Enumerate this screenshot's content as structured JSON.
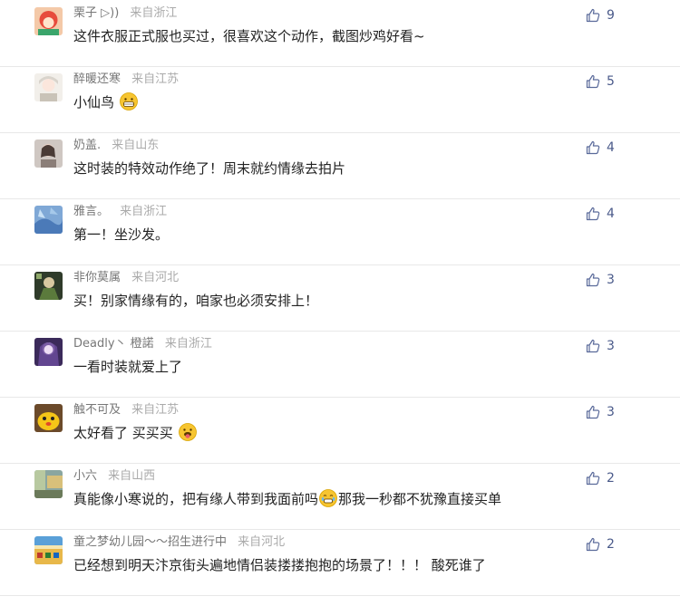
{
  "comments": [
    {
      "username": "栗子 ▷))",
      "location": "来自浙江",
      "likes": "9",
      "text": "这件衣服正式服也买过，很喜欢这个动作，截图炒鸡好看~",
      "text_after": ""
    },
    {
      "username": "醉暖还寒",
      "location": "来自江苏",
      "likes": "5",
      "text": "小仙鸟",
      "text_after": ""
    },
    {
      "username": "奶盖.",
      "location": "来自山东",
      "likes": "4",
      "text": "这时装的特效动作绝了！周末就约情缘去拍片",
      "text_after": ""
    },
    {
      "username": "雅言。",
      "location": "来自浙江",
      "likes": "4",
      "text": "第一！坐沙发。",
      "text_after": ""
    },
    {
      "username": "非你莫属",
      "location": "来自河北",
      "likes": "3",
      "text": "买！别家情缘有的，咱家也必须安排上！",
      "text_after": ""
    },
    {
      "username": "Deadly丶 橙諾",
      "location": "来自浙江",
      "likes": "3",
      "text": "一看时装就爱上了",
      "text_after": ""
    },
    {
      "username": "触不可及",
      "location": "来自江苏",
      "likes": "3",
      "text": "太好看了 买买买",
      "text_after": ""
    },
    {
      "username": "小六",
      "location": "来自山西",
      "likes": "2",
      "text": "真能像小寒说的，把有缘人带到我面前吗",
      "text_after": "那我一秒都不犹豫直接买单"
    },
    {
      "username": "童之梦幼儿园～～招生进行中",
      "location": "来自河北",
      "likes": "2",
      "text": "已经想到明天汴京街头遍地情侣装搂搂抱抱的场景了！！！ 酸死谁了",
      "text_after": ""
    }
  ],
  "colors": {
    "username": "#777777",
    "location": "#aaaaaa",
    "like_icon": "#5a6a9a",
    "divider": "#e8e8e8"
  },
  "icons": {
    "like": "thumbs-up-icon",
    "emoji_grin": "grinning-face-icon",
    "emoji_tongue": "tongue-out-face-icon",
    "emoji_tears": "teary-face-icon",
    "voice": "sound-wave-icon"
  }
}
